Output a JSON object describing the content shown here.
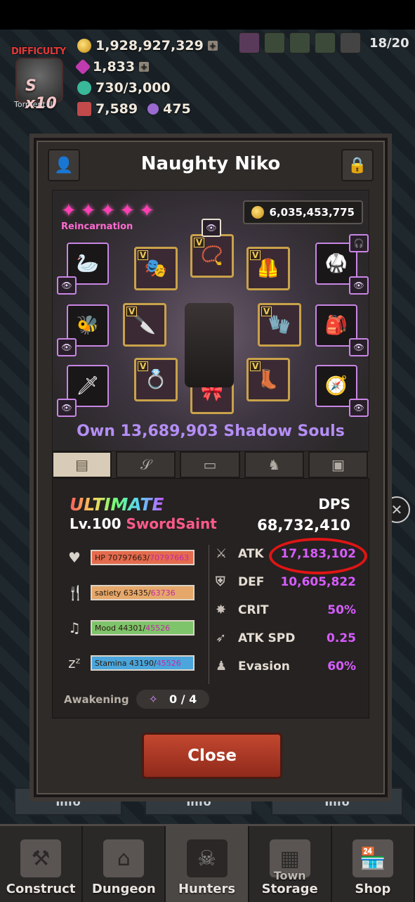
{
  "hud": {
    "gold": "1,928,927,329",
    "gems": "1,833",
    "essence": "730/3,000",
    "tickets": "7,589",
    "crystals": "475",
    "difficulty_label": "DIFFICULTY",
    "difficulty_level": "S x10",
    "difficulty_name": "Torment III",
    "population": "18/20"
  },
  "dialog": {
    "title": "Naughty Niko",
    "reincarnation_label": "Reincarnation",
    "gold_value": "6,035,453,775",
    "shadow_souls": "Own 13,689,903 Shadow Souls",
    "tabs": [
      "info-tab",
      "scroll-tab",
      "book-tab",
      "horse-tab",
      "bag-tab"
    ],
    "grade": "ULTIMATE",
    "level_prefix": "Lv.100",
    "class_name": "SwordSaint",
    "dps_label": "DPS",
    "dps_value": "68,732,410",
    "bars": {
      "hp": {
        "label": "HP 70797663/",
        "max": "70797663"
      },
      "satiety": {
        "label": "satiety 63435/",
        "max": "63736"
      },
      "mood": {
        "label": "Mood 44301/",
        "max": "45526"
      },
      "stamina": {
        "label": "Stamina 43190/",
        "max": "45526"
      }
    },
    "stats": [
      {
        "name": "ATK",
        "value": "17,183,102"
      },
      {
        "name": "DEF",
        "value": "10,605,822"
      },
      {
        "name": "CRIT",
        "value": "50%"
      },
      {
        "name": "ATK SPD",
        "value": "0.25"
      },
      {
        "name": "Evasion",
        "value": "60%"
      }
    ],
    "awakening_label": "Awakening",
    "awakening_value": "0 / 4",
    "close_label": "Close"
  },
  "info_strips": [
    "Info",
    "Info",
    "Info"
  ],
  "nav": {
    "items": [
      {
        "label": "Construct"
      },
      {
        "label": "Dungeon"
      },
      {
        "label": "Hunters"
      },
      {
        "label": "Storage"
      },
      {
        "label": "Shop"
      }
    ],
    "storage_overlay": "Town"
  },
  "colors": {
    "accent_purple": "#d75cff",
    "close_button": "#b13d28",
    "highlight_circle": "#e01515"
  }
}
